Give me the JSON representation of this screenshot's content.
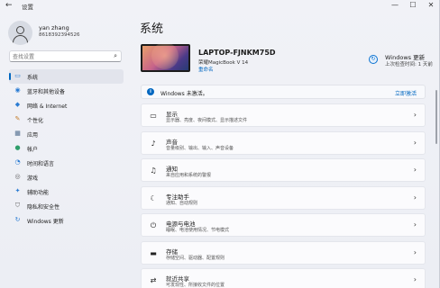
{
  "window": {
    "back_glyph": "←",
    "title": "设置",
    "controls": [
      "—",
      "☐",
      "✕"
    ]
  },
  "user": {
    "name": "yan zhang",
    "phone": "8618392394526"
  },
  "search": {
    "placeholder": "查找设置",
    "icon": "search-icon"
  },
  "sidebar": {
    "items": [
      {
        "label": "系统",
        "icon": "monitor-icon",
        "glyph": "▭",
        "color": "#2b7cd3",
        "active": true
      },
      {
        "label": "蓝牙和其他设备",
        "icon": "bluetooth-icon",
        "glyph": "◉",
        "color": "#2b7cd3",
        "active": false
      },
      {
        "label": "网络 & Internet",
        "icon": "wifi-icon",
        "glyph": "◆",
        "color": "#2b7cd3",
        "active": false
      },
      {
        "label": "个性化",
        "icon": "brush-icon",
        "glyph": "✎",
        "color": "#c47b2b",
        "active": false
      },
      {
        "label": "应用",
        "icon": "apps-icon",
        "glyph": "▦",
        "color": "#4d6a8c",
        "active": false
      },
      {
        "label": "帐户",
        "icon": "person-icon",
        "glyph": "●",
        "color": "#2e9e6b",
        "active": false
      },
      {
        "label": "时间和语言",
        "icon": "globe-clock-icon",
        "glyph": "◔",
        "color": "#2b7cd3",
        "active": false
      },
      {
        "label": "游戏",
        "icon": "gamepad-icon",
        "glyph": "◎",
        "color": "#666666",
        "active": false
      },
      {
        "label": "辅助功能",
        "icon": "accessibility-icon",
        "glyph": "✦",
        "color": "#2b7cd3",
        "active": false
      },
      {
        "label": "隐私和安全性",
        "icon": "shield-icon",
        "glyph": "⛉",
        "color": "#666666",
        "active": false
      },
      {
        "label": "Windows 更新",
        "icon": "windows-update-icon",
        "glyph": "↻",
        "color": "#2b7cd3",
        "active": false
      }
    ]
  },
  "main": {
    "title": "系统",
    "device": {
      "name": "LAPTOP-FJNKM75D",
      "model": "荣耀MagicBook V 14",
      "rename": "重命名"
    },
    "windows_update": {
      "title": "Windows 更新",
      "subtitle": "上次检查时间: 1 天前",
      "icon": "windows-update-icon"
    },
    "activation": {
      "text": "Windows 未激活。",
      "action": "立即激活"
    },
    "cards": [
      {
        "title": "显示",
        "desc": "显示器、亮度、夜间模式、显示描述文件",
        "icon": "display-icon",
        "glyph": "▭"
      },
      {
        "title": "声音",
        "desc": "音量级别、输出、输入、声音设备",
        "icon": "speaker-icon",
        "glyph": "♪"
      },
      {
        "title": "通知",
        "desc": "来自应用和系统的警报",
        "icon": "bell-icon",
        "glyph": "♫"
      },
      {
        "title": "专注助手",
        "desc": "通知、自动规则",
        "icon": "focus-moon-icon",
        "glyph": "☾"
      },
      {
        "title": "电源与电池",
        "desc": "睡眠、电池使用情况、节电模式",
        "icon": "power-icon",
        "glyph": "⏻"
      },
      {
        "title": "存储",
        "desc": "存储空间、驱动器、配置规则",
        "icon": "storage-icon",
        "glyph": "▬"
      },
      {
        "title": "就近共享",
        "desc": "可发现性、所接收文件的位置",
        "icon": "nearby-share-icon",
        "glyph": "⇄"
      }
    ]
  }
}
